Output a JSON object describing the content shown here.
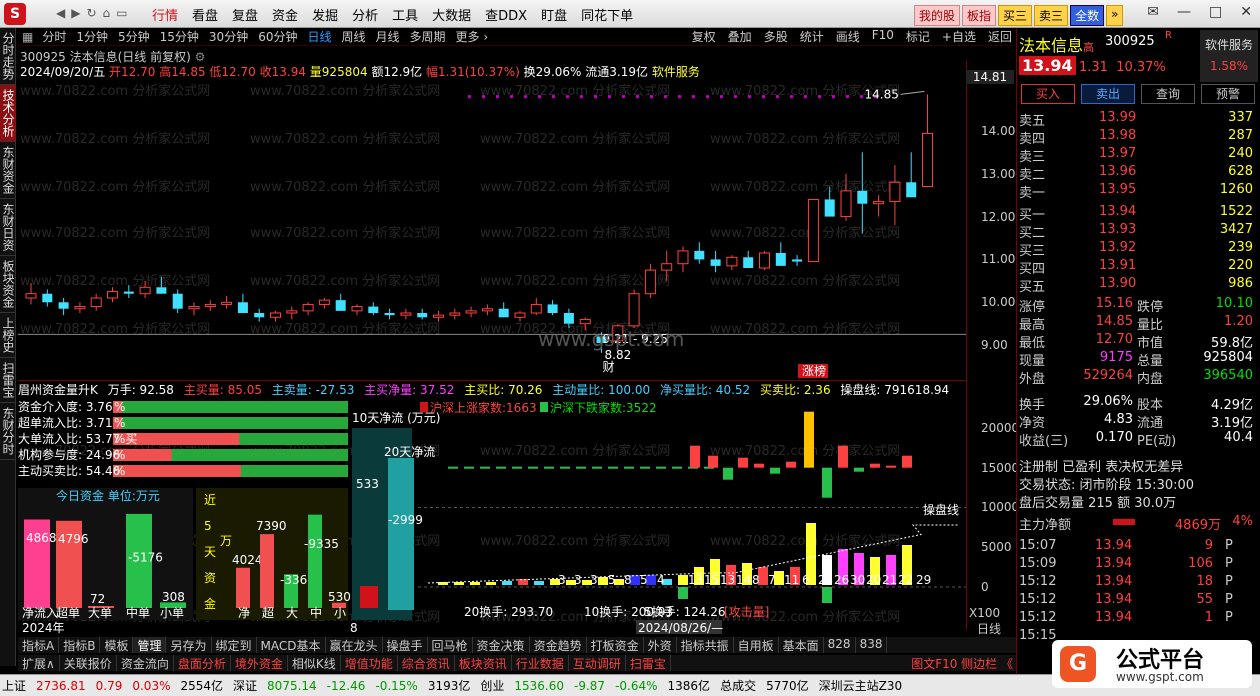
{
  "menubar": {
    "nav": [
      "◀",
      "▶",
      "↻",
      "⌂",
      "▭"
    ],
    "items": [
      "行情",
      "看盘",
      "复盘",
      "资金",
      "发掘",
      "分析",
      "工具",
      "大数据",
      "查DDX",
      "盯盘",
      "同花下单"
    ],
    "active_index": 0,
    "buttons": [
      "我的股",
      "板指",
      "买三",
      "卖三",
      "全数",
      "»"
    ],
    "window": [
      "✉",
      "—",
      "□",
      "✕"
    ]
  },
  "leftnav": [
    "分时走势",
    "技术分析",
    "东财资金",
    "东财日资",
    "板块资金",
    "上榜史",
    "扫雷宝",
    "东财分时"
  ],
  "timeframes": [
    "分时",
    "1分钟",
    "5分钟",
    "15分钟",
    "30分钟",
    "60分钟",
    "日线",
    "周线",
    "月线",
    "多周期",
    "更多 ›"
  ],
  "tf_selected": 6,
  "tools": [
    "复权",
    "叠加",
    "多股",
    "统计",
    "画线",
    "F10",
    "标记",
    "+自选",
    "返回"
  ],
  "stock_line": "300925 法本信息(日线 前复权)",
  "ohlc": {
    "date": "2024/09/20/五",
    "open": "开12.70",
    "high": "高14.85",
    "low": "低12.70",
    "close": "收13.94",
    "vol": "量925804",
    "amt": "额12.9亿",
    "amp": "幅1.31(10.37%)",
    "turn": "换29.06%",
    "float": "流通3.19亿",
    "sector": "软件服务"
  },
  "price_ticks": [
    "14.81",
    "14.00",
    "13.00",
    "12.00",
    "11.00",
    "10.00",
    "9.00"
  ],
  "annotations": {
    "high": "14.85",
    "low": "8.82",
    "range": "9.21 - 9.25",
    "cai": "财",
    "zhangbang": "涨榜"
  },
  "watermark": "www.70822.com  分析家公式网",
  "gspt": "www.gspt.com",
  "fund": {
    "title": "眉州资金量升K",
    "wanshou": "万手: 92.58",
    "zhumai": "主买量: 85.05",
    "zhumai2": "主卖量: -27.53",
    "zhu_net": "主买净量: 37.52",
    "zhumaibi": "主买比: 70.26",
    "zhudong": "主动量比: 100.00",
    "jing_mai": "净买量比: 40.52",
    "maimai": "买卖比: 2.36",
    "caopan": "操盘线: 791618.94"
  },
  "fund_rows": [
    {
      "label": "资金介入度: 3.76",
      "pct": "%"
    },
    {
      "label": "超单流入比: 3.71",
      "pct": "%"
    },
    {
      "label": "大单流入比: 53.77",
      "pct": "%买"
    },
    {
      "label": "机构参与度: 24.96",
      "pct": "%"
    },
    {
      "label": "主动买卖比: 54.46",
      "pct": "%"
    }
  ],
  "today_fund": {
    "title": "今日资金 单位:万元",
    "values": [
      "4868",
      "4796",
      "72",
      "-5176",
      "308"
    ],
    "labels": [
      "净流入",
      "超单",
      "大单",
      "中单",
      "小单"
    ]
  },
  "five_day": {
    "title": [
      "近",
      "5",
      "天",
      "资",
      "金"
    ],
    "unit": "万",
    "values": [
      "4024",
      "7390",
      "-3366",
      "-9335",
      "530"
    ],
    "labels": [
      "净",
      "超",
      "大",
      "中",
      "小"
    ]
  },
  "ten_day": {
    "title": "10天净流 (万元)",
    "value": "533"
  },
  "twenty_day": {
    "title": "20天净流",
    "value": "-2999"
  },
  "updown": {
    "up": "沪深上涨家数:1663",
    "down": "沪深下跌家数:3522"
  },
  "low_ticks": [
    "20000",
    "15000",
    "10000",
    "5000",
    "0"
  ],
  "caopanxian": "操盘线",
  "counts": [
    "3",
    "3",
    "3",
    "5",
    "8",
    "5",
    "4",
    "13",
    "15",
    "13",
    "14",
    "8",
    "7",
    "11",
    "6",
    "25",
    "26",
    "30",
    "20",
    "21",
    "22",
    "29"
  ],
  "turnover": {
    "t20": "20换手: 293.70",
    "t10": "10换手: 200.93",
    "t5": "5换手: 124.26",
    "atk": "[攻击量]"
  },
  "x100": "X100",
  "rixian": "日线",
  "year": "2024年",
  "month": "8",
  "cursor_date": "2024/08/26/—",
  "bottom_tabs1": [
    "指标A",
    "指标B",
    "模板",
    "管理",
    "另存为",
    "绑定到",
    "MACD基本",
    "赢在龙头",
    "操盘手",
    "回马枪",
    "资金决策",
    "资金趋势",
    "打板资金",
    "外资",
    "指标共振",
    "自用板",
    "基本面",
    "828",
    "838"
  ],
  "bottom_tabs1_sel": 3,
  "bottom_tabs2": [
    "扩展∧",
    "关联报价",
    "资金流向",
    "盘面分析",
    "境外资金",
    "相似K线",
    "增值功能",
    "综合资讯",
    "板块资讯",
    "行业数据",
    "互动调研",
    "扫雷宝"
  ],
  "bottom_right": "图文F10 侧边栏 《",
  "status": {
    "sh_l": "上证",
    "sh_v": "2736.81",
    "sh_c": "0.79",
    "sh_p": "0.03%",
    "sh_a": "2554亿",
    "sz_l": "深证",
    "sz_v": "8075.14",
    "sz_c": "-12.46",
    "sz_p": "-0.15%",
    "sz_a": "3193亿",
    "cy_l": "创业",
    "cy_v": "1536.60",
    "cy_c": "-9.87",
    "cy_p": "-0.64%",
    "cy_a": "1386亿",
    "tot_l": "总成交",
    "tot_v": "5770亿",
    "site": "深圳云主站Z30"
  },
  "rp": {
    "name": "法本信息",
    "name_mark": "高",
    "code": "300925",
    "r": "R",
    "sw": "软件服务",
    "sw_pct": "1.58%",
    "price": "13.94",
    "chg": "1.31",
    "chg_p": "10.37%",
    "btns": [
      "买入",
      "卖出",
      "查询",
      "预警"
    ]
  },
  "asks": [
    {
      "l": "卖五",
      "p": "13.99",
      "v": "337"
    },
    {
      "l": "卖四",
      "p": "13.98",
      "v": "287"
    },
    {
      "l": "卖三",
      "p": "13.97",
      "v": "240"
    },
    {
      "l": "卖二",
      "p": "13.96",
      "v": "628"
    },
    {
      "l": "卖一",
      "p": "13.95",
      "v": "1260"
    }
  ],
  "bids": [
    {
      "l": "买一",
      "p": "13.94",
      "v": "1522"
    },
    {
      "l": "买二",
      "p": "13.93",
      "v": "3427"
    },
    {
      "l": "买三",
      "p": "13.92",
      "v": "239"
    },
    {
      "l": "买四",
      "p": "13.91",
      "v": "220"
    },
    {
      "l": "买五",
      "p": "13.90",
      "v": "986"
    }
  ],
  "stats": [
    {
      "l1": "涨停",
      "v1": "15.16",
      "c1": "red",
      "l2": "跌停",
      "v2": "10.10",
      "c2": "green"
    },
    {
      "l1": "最高",
      "v1": "14.85",
      "c1": "red",
      "l2": "量比",
      "v2": "1.20",
      "c2": "red"
    },
    {
      "l1": "最低",
      "v1": "12.70",
      "c1": "red",
      "l2": "市值",
      "v2": "59.8亿",
      "c2": "white"
    },
    {
      "l1": "现量",
      "v1": "9175",
      "c1": "magenta",
      "l2": "总量",
      "v2": "925804",
      "c2": "white"
    },
    {
      "l1": "外盘",
      "v1": "529264",
      "c1": "red",
      "l2": "内盘",
      "v2": "396540",
      "c2": "green"
    }
  ],
  "stats2": [
    {
      "l1": "换手",
      "v1": "29.06%",
      "l2": "股本",
      "v2": "4.29亿"
    },
    {
      "l1": "净资",
      "v1": "4.83",
      "l2": "流通",
      "v2": "3.19亿"
    },
    {
      "l1": "收益(三)",
      "v1": "0.170",
      "l2": "PE(动)",
      "v2": "40.4"
    }
  ],
  "info_lines": [
    "注册制 已盈利 表决权无差异",
    "交易状态: 闭市阶段 15:30:00",
    "盘后交易量 215 额 30.0万"
  ],
  "zhuli": {
    "label": "主力净额",
    "value": "4869万",
    "pct": "4%"
  },
  "trades": [
    {
      "t": "15:07",
      "p": "13.94",
      "v": "9",
      "bs": "P"
    },
    {
      "t": "15:09",
      "p": "13.94",
      "v": "106",
      "bs": "P"
    },
    {
      "t": "15:12",
      "p": "13.94",
      "v": "18",
      "bs": "P"
    },
    {
      "t": "15:12",
      "p": "13.94",
      "v": "55",
      "bs": "P"
    },
    {
      "t": "15:12",
      "p": "13.94",
      "v": "1",
      "bs": "P"
    },
    {
      "t": "15:15",
      "p": "",
      "v": "",
      "bs": ""
    }
  ],
  "gspt_logo": {
    "icon": "G",
    "t1": "公式平台",
    "t2": "www.gspt.com"
  },
  "colors": {
    "up": "#ff4040",
    "down": "#00e0ff",
    "bg": "#000000",
    "axis": "#700000"
  },
  "chart_data": {
    "type": "candlestick",
    "ylim": [
      8.7,
      15.0
    ],
    "candles": [
      [
        10.1,
        10.45,
        9.95,
        10.2
      ],
      [
        10.2,
        10.3,
        9.9,
        10.0
      ],
      [
        10.0,
        10.1,
        9.7,
        9.85
      ],
      [
        9.85,
        10.0,
        9.75,
        9.9
      ],
      [
        9.9,
        10.2,
        9.8,
        10.1
      ],
      [
        10.1,
        10.35,
        10.0,
        10.25
      ],
      [
        10.25,
        10.4,
        10.1,
        10.2
      ],
      [
        10.2,
        10.5,
        10.1,
        10.35
      ],
      [
        10.35,
        10.6,
        10.2,
        10.2
      ],
      [
        10.2,
        10.3,
        9.75,
        9.85
      ],
      [
        9.85,
        10.0,
        9.7,
        9.9
      ],
      [
        9.9,
        10.05,
        9.8,
        9.95
      ],
      [
        9.95,
        10.15,
        9.85,
        10.0
      ],
      [
        10.0,
        10.2,
        9.85,
        9.75
      ],
      [
        9.75,
        9.85,
        9.55,
        9.65
      ],
      [
        9.65,
        9.8,
        9.55,
        9.75
      ],
      [
        9.75,
        9.9,
        9.6,
        9.8
      ],
      [
        9.8,
        10.0,
        9.7,
        9.95
      ],
      [
        9.95,
        10.1,
        9.85,
        10.05
      ],
      [
        10.05,
        10.2,
        9.95,
        9.8
      ],
      [
        9.8,
        9.95,
        9.7,
        9.9
      ],
      [
        9.9,
        10.0,
        9.7,
        9.75
      ],
      [
        9.75,
        9.85,
        9.6,
        9.7
      ],
      [
        9.7,
        9.85,
        9.6,
        9.75
      ],
      [
        9.75,
        9.85,
        9.6,
        9.65
      ],
      [
        9.65,
        9.8,
        9.55,
        9.7
      ],
      [
        9.7,
        9.85,
        9.6,
        9.75
      ],
      [
        9.75,
        9.9,
        9.65,
        9.8
      ],
      [
        9.8,
        9.95,
        9.7,
        9.85
      ],
      [
        9.85,
        10.0,
        9.75,
        9.65
      ],
      [
        9.65,
        9.8,
        9.55,
        9.75
      ],
      [
        9.75,
        10.1,
        9.7,
        9.95
      ],
      [
        9.95,
        10.05,
        9.7,
        9.75
      ],
      [
        9.75,
        9.85,
        9.4,
        9.5
      ],
      [
        9.5,
        9.65,
        9.35,
        9.6
      ],
      [
        9.2,
        9.3,
        8.82,
        9.05
      ],
      [
        9.1,
        9.5,
        9.05,
        9.45
      ],
      [
        9.45,
        10.3,
        9.4,
        10.2
      ],
      [
        10.2,
        10.9,
        10.1,
        10.75
      ],
      [
        10.75,
        11.2,
        10.5,
        10.9
      ],
      [
        10.9,
        11.3,
        10.7,
        11.2
      ],
      [
        11.2,
        11.4,
        10.9,
        11.0
      ],
      [
        11.0,
        11.2,
        10.7,
        10.85
      ],
      [
        10.85,
        11.1,
        10.75,
        11.05
      ],
      [
        11.05,
        11.2,
        10.8,
        10.8
      ],
      [
        10.8,
        11.2,
        10.75,
        11.15
      ],
      [
        11.15,
        11.4,
        10.9,
        10.85
      ],
      [
        11.0,
        11.1,
        10.85,
        10.95
      ],
      [
        10.95,
        12.4,
        10.95,
        12.4
      ],
      [
        12.4,
        12.7,
        12.0,
        12.0
      ],
      [
        12.0,
        13.0,
        11.9,
        12.6
      ],
      [
        12.6,
        13.5,
        11.6,
        12.3
      ],
      [
        12.3,
        12.5,
        12.0,
        12.35
      ],
      [
        12.35,
        13.2,
        11.8,
        12.8
      ],
      [
        12.8,
        13.5,
        12.5,
        12.45
      ],
      [
        12.7,
        14.85,
        12.7,
        13.94
      ]
    ]
  }
}
